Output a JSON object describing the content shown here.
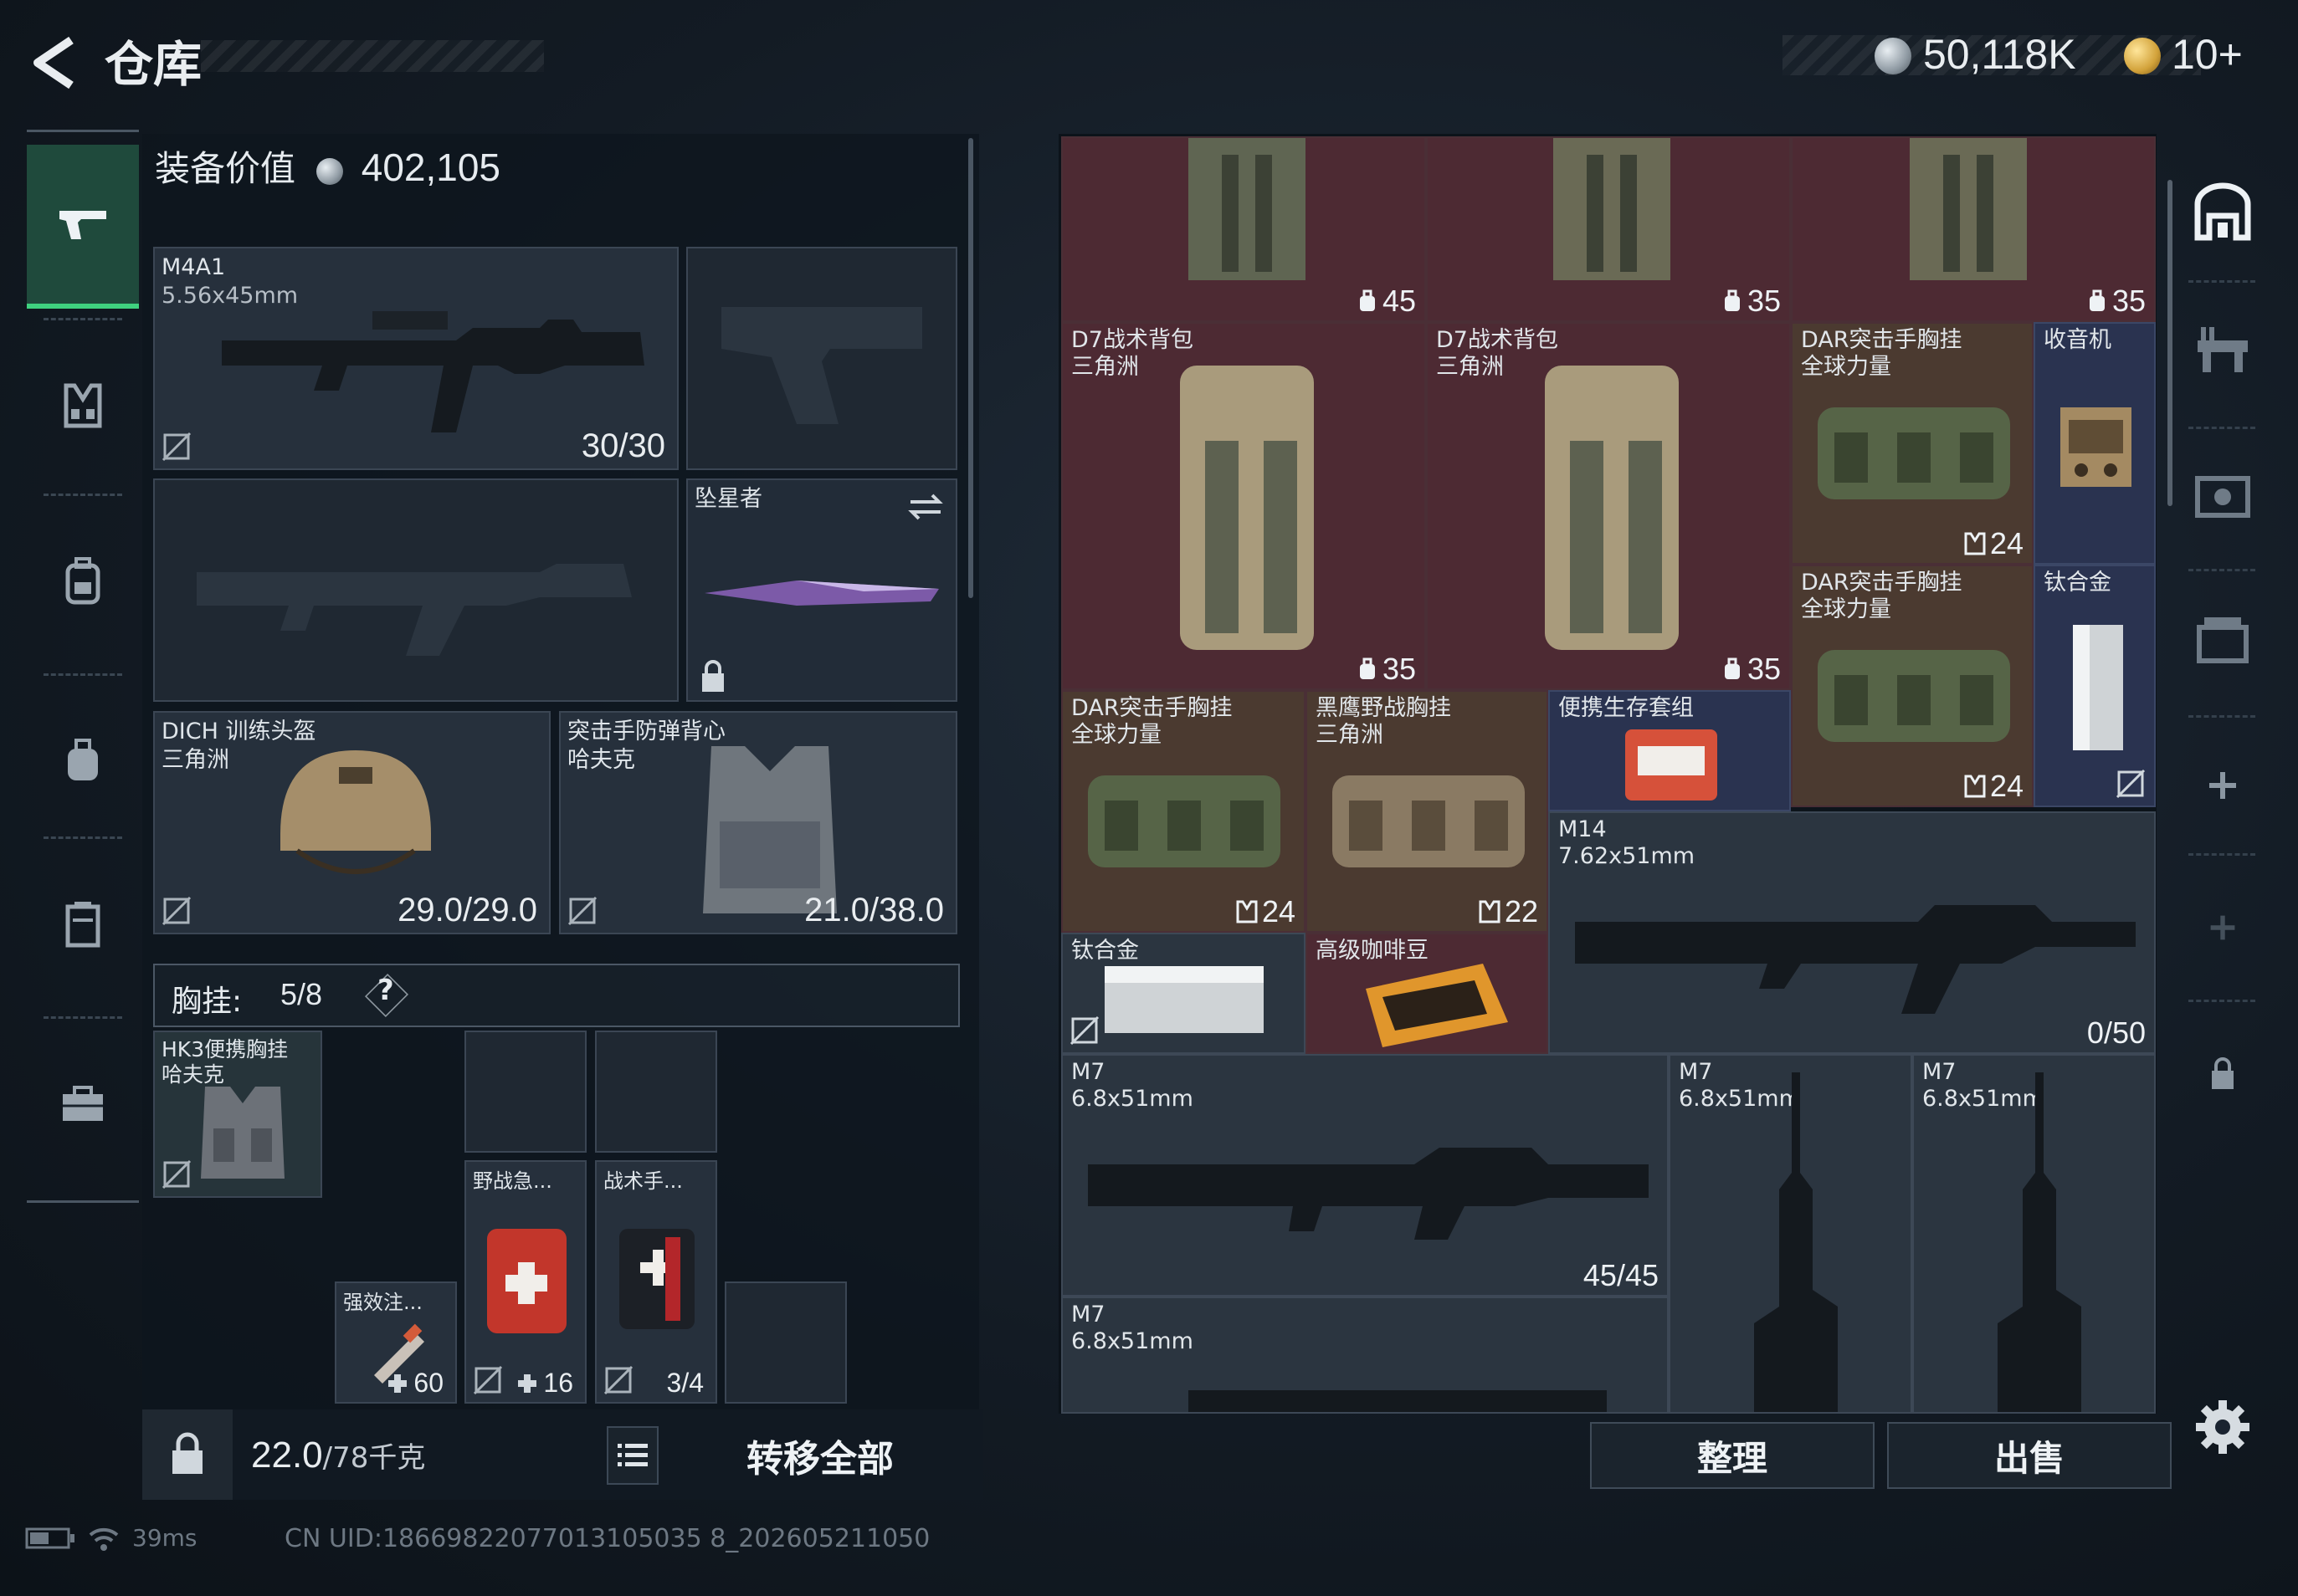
{
  "header": {
    "title": "仓库",
    "currencies": [
      {
        "icon": "silver-coin-icon",
        "value": "50,118K"
      },
      {
        "icon": "gold-coin-icon",
        "value": "10+"
      }
    ]
  },
  "left_nav": [
    {
      "icon": "pistol-icon",
      "active": true
    },
    {
      "icon": "chest-rig-icon"
    },
    {
      "icon": "backpack-icon"
    },
    {
      "icon": "pouch-icon"
    },
    {
      "icon": "safe-case-icon"
    },
    {
      "icon": "briefcase-icon"
    }
  ],
  "equipment": {
    "label": "装备价值",
    "value": "402,105",
    "primary_weapon": {
      "name": "M4A1",
      "caliber": "5.56x45mm",
      "ammo": "30/30"
    },
    "melee": {
      "name": "坠星者"
    },
    "helmet": {
      "name": "DICH 训练头盔",
      "source": "三角洲",
      "durability": "29.0/29.0"
    },
    "armor": {
      "name": "突击手防弹背心",
      "source": "哈夫克",
      "durability": "21.0/38.0"
    },
    "rig_label": "胸挂:",
    "rig_capacity": "5/8",
    "rig_help": "?",
    "rig": {
      "name": "HK3便携胸挂",
      "source": "哈夫克"
    },
    "rig_items": [
      {
        "name": "强效注...",
        "count": "60"
      },
      {
        "name": "野战急...",
        "count": "16"
      },
      {
        "name": "战术手...",
        "count": "3/4"
      }
    ]
  },
  "footer_left": {
    "weight": "22.0",
    "weight_max": "/78千克",
    "transfer_all": "转移全部"
  },
  "storage": {
    "cells": [
      {
        "name": "",
        "count": "45"
      },
      {
        "name": "",
        "count": "35"
      },
      {
        "name": "",
        "count": "35"
      },
      {
        "name": "D7战术背包\n三角洲",
        "count": "35"
      },
      {
        "name": "D7战术背包\n三角洲",
        "count": "35"
      },
      {
        "name": "DAR突击手胸挂\n全球力量",
        "count": "24"
      },
      {
        "name": "收音机",
        "count": ""
      },
      {
        "name": "DAR突击手胸挂\n全球力量",
        "count": "24"
      },
      {
        "name": "钛合金",
        "count": ""
      },
      {
        "name": "DAR突击手胸挂\n全球力量",
        "count": "24"
      },
      {
        "name": "黑鹰野战胸挂\n三角洲",
        "count": "22"
      },
      {
        "name": "便携生存套组",
        "count": ""
      },
      {
        "name": "M14\n7.62x51mm",
        "count": "0/50"
      },
      {
        "name": "钛合金",
        "count": ""
      },
      {
        "name": "高级咖啡豆",
        "count": ""
      },
      {
        "name": "M7\n6.8x51mm",
        "count": "45/45"
      },
      {
        "name": "M7\n6.8x51mm",
        "count": ""
      },
      {
        "name": "M7\n6.8x51mm",
        "count": ""
      },
      {
        "name": "M7\n6.8x51mm",
        "count": ""
      }
    ]
  },
  "footer_right": {
    "organize": "整理",
    "sell": "出售"
  },
  "status": {
    "ping": "39ms",
    "uid": "CN UID:18669822077013105035 8_202605211050"
  }
}
